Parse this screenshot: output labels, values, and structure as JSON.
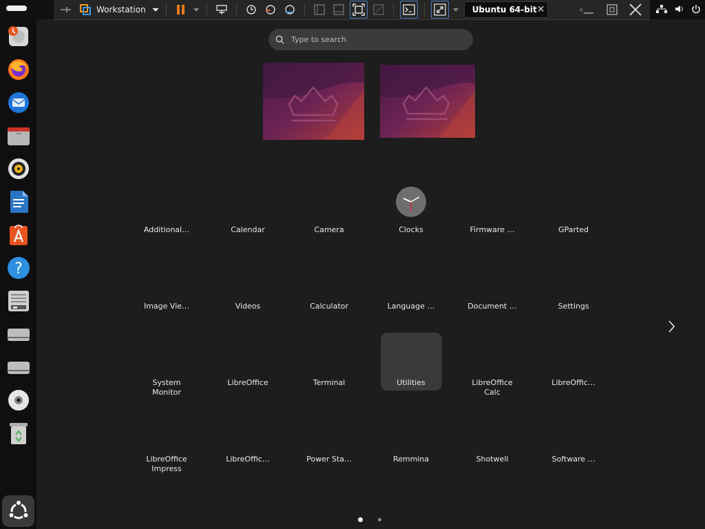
{
  "toolbar": {
    "workspace_label": "Workstation",
    "vm_tab_label": "Ubuntu 64-bit",
    "close_glyph": "✕"
  },
  "search": {
    "placeholder": "Type to search"
  },
  "dock": {
    "items": [
      {
        "name": "help-icon-glyph",
        "text": "?"
      }
    ]
  },
  "apps": [
    [
      "Additional…",
      "Calendar",
      "Camera",
      "Clocks",
      "Firmware …",
      "GParted"
    ],
    [
      "Image Vie…",
      "Videos",
      "Calculator",
      "Language …",
      "Document …",
      "Settings"
    ],
    [
      "System Monitor",
      "LibreOffice",
      "Terminal",
      "Utilities",
      "LibreOffice Calc",
      "LibreOffic…"
    ],
    [
      "LibreOffice Impress",
      "LibreOffic…",
      "Power Sta…",
      "Remmina",
      "Shotwell",
      "Software …"
    ]
  ],
  "apps_multiline": {
    "r2c0": [
      "System",
      "Monitor"
    ],
    "r2c4": [
      "LibreOffice",
      "Calc"
    ],
    "r3c0": [
      "LibreOffice",
      "Impress"
    ]
  },
  "next_page_glyph": "›",
  "colors": {
    "accent_orange": "#e95420",
    "wallpaper_purple": "#6b2354",
    "background": "#1d1d1d"
  }
}
